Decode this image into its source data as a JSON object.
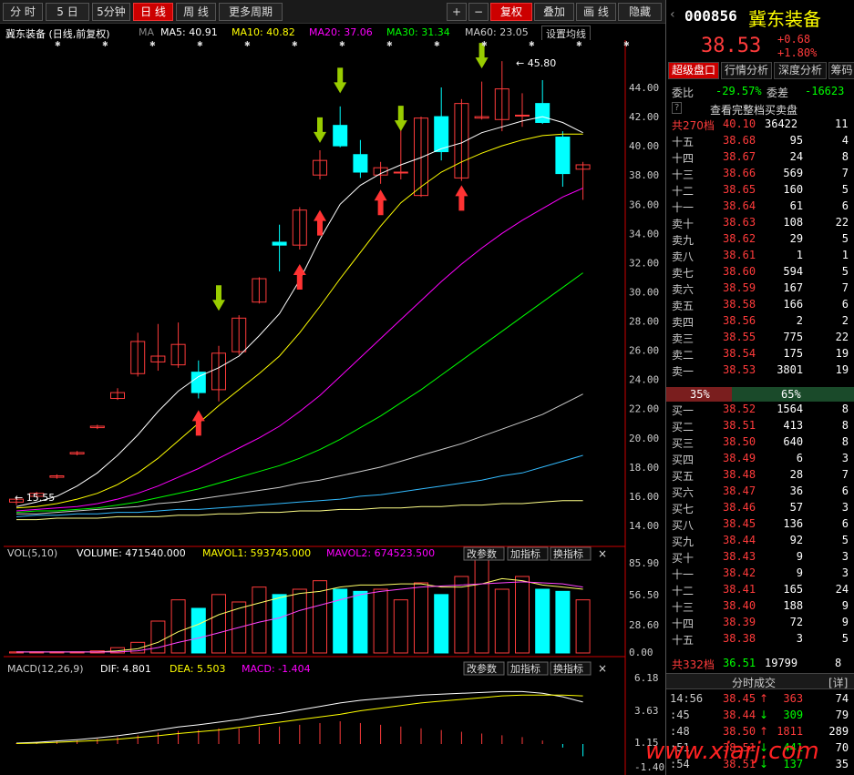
{
  "toolbar": {
    "left": [
      "分 时",
      "5 日",
      "5分钟",
      "日 线",
      "周 线",
      "更多周期"
    ],
    "right": [
      "+",
      "−",
      "复权",
      "叠加",
      "画 线",
      "隐藏"
    ]
  },
  "chart_info": {
    "name": "冀东装备 (日线,前复权)",
    "ma_label": "MA",
    "ma5": "MA5: 40.91",
    "ma10": "MA10: 40.82",
    "ma20": "MA20: 37.06",
    "ma30": "MA30: 31.34",
    "ma60": "MA60: 23.05",
    "setting": "设置均线"
  },
  "price_axis": [
    "44.00",
    "42.00",
    "40.00",
    "38.00",
    "36.00",
    "34.00",
    "32.00",
    "30.00",
    "28.00",
    "26.00",
    "24.00",
    "22.00",
    "20.00",
    "18.00",
    "16.00",
    "14.00"
  ],
  "annotations": {
    "high": "45.80",
    "low": "15.55"
  },
  "volume_panel": {
    "title": "VOL(5,10)",
    "volume": "VOLUME: 471540.000",
    "mavol1": "MAVOL1: 593745.000",
    "mavol2": "MAVOL2: 674523.500",
    "btn_params": "改参数",
    "btn_add": "加指标",
    "btn_switch": "换指标",
    "axis": [
      "85.90",
      "56.50",
      "28.60",
      "0.00"
    ]
  },
  "macd_panel": {
    "title": "MACD(12,26,9)",
    "dif": "DIF: 4.801",
    "dea": "DEA: 5.503",
    "macd": "MACD: -1.404",
    "btn_params": "改参数",
    "btn_add": "加指标",
    "btn_switch": "换指标",
    "axis": [
      "6.18",
      "3.63",
      "1.15",
      "-1.40"
    ]
  },
  "stock": {
    "code": "000856",
    "name": "冀东装备",
    "price": "38.53",
    "change": "+0.68",
    "pct": "+1.80%"
  },
  "tabs": [
    "超级盘口",
    "行情分析",
    "深度分析",
    "筹码"
  ],
  "ratio": {
    "wb_label": "委比",
    "wb_value": "-29.57%",
    "wc_label": "委差",
    "wc_value": "-16623"
  },
  "book_title": "查看完整档买卖盘",
  "ask_total": {
    "label": "共270档",
    "price": "40.10",
    "vol": "36422",
    "n": "11"
  },
  "asks": [
    {
      "label": "十五",
      "price": "38.68",
      "vol": "95",
      "n": "4"
    },
    {
      "label": "十四",
      "price": "38.67",
      "vol": "24",
      "n": "8"
    },
    {
      "label": "十三",
      "price": "38.66",
      "vol": "569",
      "n": "7"
    },
    {
      "label": "十二",
      "price": "38.65",
      "vol": "160",
      "n": "5"
    },
    {
      "label": "十一",
      "price": "38.64",
      "vol": "61",
      "n": "6"
    },
    {
      "label": "卖十",
      "price": "38.63",
      "vol": "108",
      "n": "22"
    },
    {
      "label": "卖九",
      "price": "38.62",
      "vol": "29",
      "n": "5"
    },
    {
      "label": "卖八",
      "price": "38.61",
      "vol": "1",
      "n": "1"
    },
    {
      "label": "卖七",
      "price": "38.60",
      "vol": "594",
      "n": "5"
    },
    {
      "label": "卖六",
      "price": "38.59",
      "vol": "167",
      "n": "7"
    },
    {
      "label": "卖五",
      "price": "38.58",
      "vol": "166",
      "n": "6"
    },
    {
      "label": "卖四",
      "price": "38.56",
      "vol": "2",
      "n": "2"
    },
    {
      "label": "卖三",
      "price": "38.55",
      "vol": "775",
      "n": "22"
    },
    {
      "label": "卖二",
      "price": "38.54",
      "vol": "175",
      "n": "19"
    },
    {
      "label": "卖一",
      "price": "38.53",
      "vol": "3801",
      "n": "19"
    }
  ],
  "split": {
    "sell": "35%",
    "buy": "65%"
  },
  "bids": [
    {
      "label": "买一",
      "price": "38.52",
      "vol": "1564",
      "n": "8"
    },
    {
      "label": "买二",
      "price": "38.51",
      "vol": "413",
      "n": "8"
    },
    {
      "label": "买三",
      "price": "38.50",
      "vol": "640",
      "n": "8"
    },
    {
      "label": "买四",
      "price": "38.49",
      "vol": "6",
      "n": "3"
    },
    {
      "label": "买五",
      "price": "38.48",
      "vol": "28",
      "n": "7"
    },
    {
      "label": "买六",
      "price": "38.47",
      "vol": "36",
      "n": "6"
    },
    {
      "label": "买七",
      "price": "38.46",
      "vol": "57",
      "n": "3"
    },
    {
      "label": "买八",
      "price": "38.45",
      "vol": "136",
      "n": "6"
    },
    {
      "label": "买九",
      "price": "38.44",
      "vol": "92",
      "n": "5"
    },
    {
      "label": "买十",
      "price": "38.43",
      "vol": "9",
      "n": "3"
    },
    {
      "label": "十一",
      "price": "38.42",
      "vol": "9",
      "n": "3"
    },
    {
      "label": "十二",
      "price": "38.41",
      "vol": "165",
      "n": "24"
    },
    {
      "label": "十三",
      "price": "38.40",
      "vol": "188",
      "n": "9"
    },
    {
      "label": "十四",
      "price": "38.39",
      "vol": "72",
      "n": "9"
    },
    {
      "label": "十五",
      "price": "38.38",
      "vol": "3",
      "n": "5"
    }
  ],
  "bid_total": {
    "label": "共332档",
    "price": "36.51",
    "vol": "19799",
    "n": "8"
  },
  "trades_title": "分时成交",
  "trades_detail": "[详]",
  "trades": [
    {
      "time": "14:56",
      "price": "38.45",
      "vol": "363",
      "n": "74"
    },
    {
      "time": ":45",
      "price": "38.44",
      "vol": "309",
      "n": "79"
    },
    {
      "time": ":48",
      "price": "38.50",
      "vol": "1811",
      "n": "289"
    },
    {
      "time": ":51",
      "price": "38.51",
      "vol": "441",
      "n": "70"
    },
    {
      "time": ":54",
      "price": "38.51",
      "vol": "137",
      "n": "35"
    }
  ],
  "watermark": "www.xiarj.com",
  "colors": {
    "up": "#ff3b3b",
    "down": "#00ffff",
    "ma5": "#ffffff",
    "ma10": "#ffff00",
    "ma20": "#ff00ff",
    "ma30": "#00ff00",
    "ma60": "#cccccc"
  }
}
